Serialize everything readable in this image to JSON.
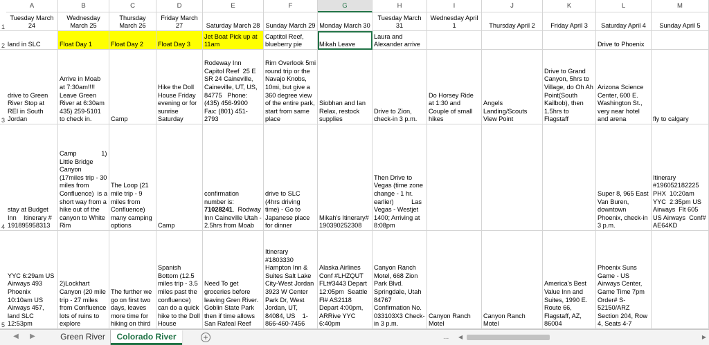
{
  "columns": [
    "A",
    "B",
    "C",
    "D",
    "E",
    "F",
    "G",
    "H",
    "I",
    "J",
    "K",
    "L",
    "M"
  ],
  "selected_column": "G",
  "rows": [
    "1",
    "2",
    "3",
    "4",
    "5"
  ],
  "cells": {
    "r1": [
      "Tuesday March 24",
      "Wednesday March 25",
      "Thursday March 26",
      "Friday March 27",
      "Saturday March 28",
      "Sunday March 29",
      "Monday March 30",
      "Tuesday March 31",
      "Wednesday April 1",
      "Thursday April 2",
      "Friday April 3",
      "Saturday April 4",
      "Sunday April 5"
    ],
    "r2": [
      "land in SLC",
      "Float Day 1",
      "Float Day 2",
      "Float Day 3",
      "Jet Boat Pick up at 11am",
      "Captitol Reef, blueberry pie",
      "Mikah Leave",
      "Laura and Alexander arrive",
      "",
      "",
      "",
      "Drive to Phoenix",
      ""
    ],
    "r3": [
      "drive to Green River Stop at REI in South Jordan",
      "Arrive in Moab at 7:30am!!!!\nLeave Green River at 6:30am 435) 259-5101 to check in.",
      "Camp",
      "Hike the Doll House Friday evening or for sunrise Saturday",
      "Rodeway Inn Capitol Reef  25 E SR 24 Caineville, Caineville, UT, US, 84775   Phone: (435) 456-9900\nFax: (801) 451-2793",
      "Rim Overlook 5mi round trip or the Navajo Knobs, 10mi, but give a 360 degree view of the entire park, start from same place",
      "Siobhan and Ian Relax, restock supplies",
      "Drive to Zion, check-in 3 p.m.",
      "Do Horsey Ride at 1:30 and Couple of small hikes",
      "Angels Landing/Scouts View Point",
      "Drive to Grand Canyon, 5hrs to Village, do Oh Ah Point(South Kailbob), then 1.5hrs to Flagstaff",
      "Arizona Science Center, 600 E. Washington St., very near hotel and arena",
      "fly to calgary"
    ],
    "r4": [
      "stay at Budget Inn    Itinerary # 191895958313",
      "Camp              1) Little Bridge Canyon  (17miles trip - 30 miles from Confluence)  is a short way from a hike out of the canyon to White Rim",
      "The Loop (21 mile trip - 9 miles from Confluence) many camping options",
      "Camp",
      "confirmation number is: 71028241.  Rodway Inn Caineville Utah - 2.5hrs from Moab",
      "drive to SLC (4hrs driving time) - Go to Japanese place for dinner",
      "Mikah's Itinerary# 190390252308",
      "Then Drive to Vegas (time zone change - 1 hr. earlier)          Las Vegas - Westjet 1400; Arriving at 8:08pm",
      "",
      "",
      "",
      "Super 8, 965 East Van Buren, downtown Phoenix, check-in 3 p.m.",
      "Itinerary #196052182225 PHX  10:20am YYC  2:35pm US Airways  Flt 605 US Airways  Conf# AE64KD"
    ],
    "r5": [
      "YYC 6:29am US Airways 493 Phoenix 10:10am US Airways 457, land SLC 12:53pm",
      "2)Lockhart Canyon (20 mile trip - 27 miles from Confluence lots of ruins to explore",
      "The further we go on first two days, leaves more time for hiking on third",
      "Spanish Bottom (12.5 miles trip - 3.5 miles past the confluence) can do a quick hike to the Doll House",
      "Need To get groceries before leaving Gren River. Goblin State Park then if time allows San Rafeal Reef",
      "Itinerary #1803330 Hampton Inn & Suites Salt Lake City-West Jordan 3923 W Center Park Dr, West Jordan, UT, 84084, US    1-866-460-7456",
      "Alaska Airlines Conf #LHZQUT FLt#3443 Depart 12:05pm  Seattle Fl# AS2118 Depart 4:00pm, ARRive YYC 6:40pm",
      "Canyon Ranch Motel, 668 Zion Park Blvd. Springdale, Utah 84767 Confirmation No. 033103X3 Check-in 3 p.m.",
      "Canyon Ranch Motel",
      "Canyon Ranch Motel",
      "America's Best Value Inn and Suites, 1990 E. Route 66, Flagstaff, AZ, 86004",
      "Phoenix Suns Game - US Airways Center, Game Time 7pm Order# S-52150/ARZ Section 204, Row 4, Seats 4-7",
      ""
    ]
  },
  "highlight_color": "#ffff00",
  "sheets": [
    {
      "name": "Green River",
      "active": false
    },
    {
      "name": "Colorado River",
      "active": true
    }
  ],
  "add_sheet_label": "+",
  "more_label": "...",
  "nav_prev": "◀",
  "nav_next": "▶"
}
